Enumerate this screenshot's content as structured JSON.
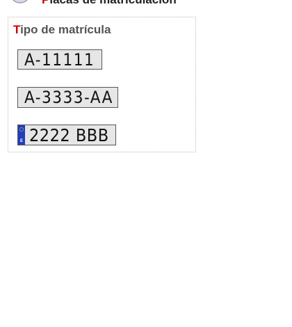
{
  "header": {
    "title_first": "P",
    "title_rest": "lacas de matriculación"
  },
  "panel": {
    "title_first": "T",
    "title_rest": "ipo de matrícula"
  },
  "plates": [
    {
      "text": "A-11111"
    },
    {
      "text": "A-3333-AA"
    },
    {
      "text": "2222 BBB",
      "eu_code": "E"
    }
  ],
  "colors": {
    "accent_red": "#cc0000",
    "plate_bg": "#e6e6e6",
    "eu_blue": "#1f3fbf"
  }
}
